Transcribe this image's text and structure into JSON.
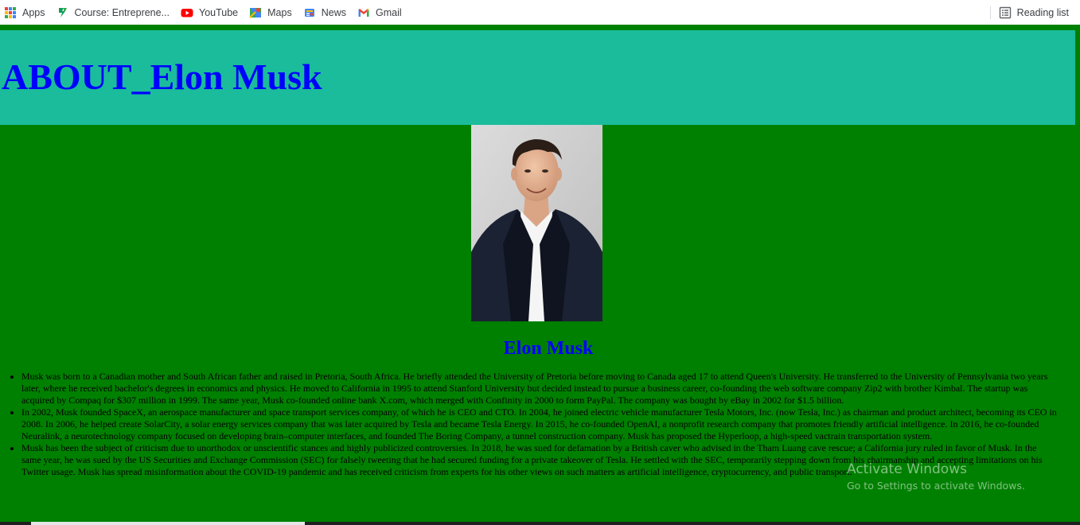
{
  "bookmarks": {
    "apps_label": "Apps",
    "items": [
      {
        "label": "Course: Entreprene...",
        "icon": "course-s-icon"
      },
      {
        "label": "YouTube",
        "icon": "youtube-icon"
      },
      {
        "label": "Maps",
        "icon": "maps-icon"
      },
      {
        "label": "News",
        "icon": "news-icon"
      },
      {
        "label": "Gmail",
        "icon": "gmail-icon"
      }
    ],
    "reading_list_label": "Reading list"
  },
  "colors": {
    "page_background": "#008000",
    "header_background": "#1abc9c",
    "heading_text": "#0000ff",
    "body_text": "#000000"
  },
  "page": {
    "title": "ABOUT_Elon Musk",
    "photo_alt": "Elon Musk",
    "person_name": "Elon Musk",
    "bio": [
      "Musk was born to a Canadian mother and South African father and raised in Pretoria, South Africa. He briefly attended the University of Pretoria before moving to Canada aged 17 to attend Queen's University. He transferred to the University of Pennsylvania two years later, where he received bachelor's degrees in economics and physics. He moved to California in 1995 to attend Stanford University but decided instead to pursue a business career, co-founding the web software company Zip2 with brother Kimbal. The startup was acquired by Compaq for $307 million in 1999. The same year, Musk co-founded online bank X.com, which merged with Confinity in 2000 to form PayPal. The company was bought by eBay in 2002 for $1.5 billion.",
      "In 2002, Musk founded SpaceX, an aerospace manufacturer and space transport services company, of which he is CEO and CTO. In 2004, he joined electric vehicle manufacturer Tesla Motors, Inc. (now Tesla, Inc.) as chairman and product architect, becoming its CEO in 2008. In 2006, he helped create SolarCity, a solar energy services company that was later acquired by Tesla and became Tesla Energy. In 2015, he co-founded OpenAI, a nonprofit research company that promotes friendly artificial intelligence. In 2016, he co-founded Neuralink, a neurotechnology company focused on developing brain–computer interfaces, and founded The Boring Company, a tunnel construction company. Musk has proposed the Hyperloop, a high-speed vactrain transportation system.",
      "Musk has been the subject of criticism due to unorthodox or unscientific stances and highly publicized controversies. In 2018, he was sued for defamation by a British caver who advised in the Tham Luang cave rescue; a California jury ruled in favor of Musk. In the same year, he was sued by the US Securities and Exchange Commission (SEC) for falsely tweeting that he had secured funding for a private takeover of Tesla. He settled with the SEC, temporarily stepping down from his chairmanship and accepting limitations on his Twitter usage. Musk has spread misinformation about the COVID-19 pandemic and has received criticism from experts for his other views on such matters as artificial intelligence, cryptocurrency, and public transport."
    ]
  },
  "watermark": {
    "line1": "Activate Windows",
    "line2": "Go to Settings to activate Windows."
  }
}
